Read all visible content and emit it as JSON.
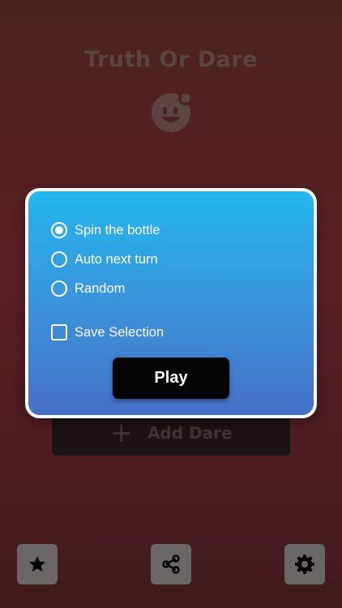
{
  "app": {
    "title": "Truth Or Dare"
  },
  "background_button": {
    "label": "Add Dare",
    "icon": "plus-icon"
  },
  "modal": {
    "options": [
      {
        "label": "Spin the bottle",
        "selected": true
      },
      {
        "label": "Auto next turn",
        "selected": false
      },
      {
        "label": "Random",
        "selected": false
      }
    ],
    "save_selection": {
      "label": "Save Selection",
      "checked": false
    },
    "play_label": "Play"
  },
  "toolbar": {
    "favorites_icon": "star-icon",
    "share_icon": "share-icon",
    "settings_icon": "gear-icon"
  },
  "colors": {
    "modal_top": "#23b7ee",
    "modal_bottom": "#4670c7",
    "play_button": "#050505",
    "toolbar_button": "#6a6666"
  }
}
